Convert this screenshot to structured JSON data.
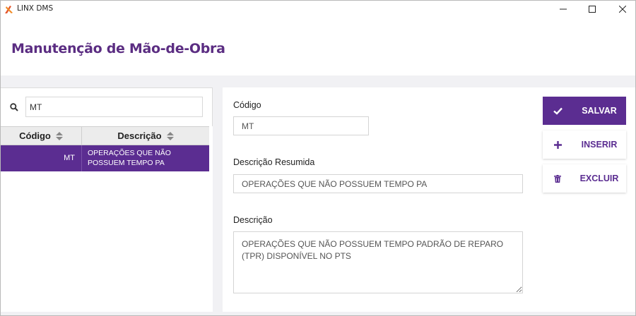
{
  "window": {
    "app_title": "LINX DMS",
    "controls": {
      "minimize": "minimize",
      "maximize": "maximize",
      "close": "close"
    }
  },
  "header": {
    "title": "Manutenção de Mão-de-Obra"
  },
  "search": {
    "value": "MT"
  },
  "grid": {
    "columns": {
      "code": "Código",
      "description": "Descrição"
    },
    "rows": [
      {
        "code": "MT",
        "description": "OPERAÇÕES QUE NÃO POSSUEM TEMPO PA",
        "selected": true
      }
    ]
  },
  "form": {
    "code": {
      "label": "Código",
      "value": "MT"
    },
    "short_description": {
      "label": "Descrição Resumida",
      "value": "OPERAÇÕES QUE NÃO POSSUEM TEMPO PA"
    },
    "description": {
      "label": "Descrição",
      "value": "OPERAÇÕES QUE NÃO POSSUEM TEMPO PADRÃO DE REPARO (TPR) DISPONÍVEL NO PTS"
    }
  },
  "actions": {
    "save": {
      "label": "SALVAR",
      "icon": "check-icon"
    },
    "insert": {
      "label": "INSERIR",
      "icon": "plus-icon"
    },
    "delete": {
      "label": "EXCLUIR",
      "icon": "trash-icon"
    }
  },
  "colors": {
    "primary": "#5b2d91",
    "title": "#5b2d82",
    "background": "#f1f1f4"
  }
}
